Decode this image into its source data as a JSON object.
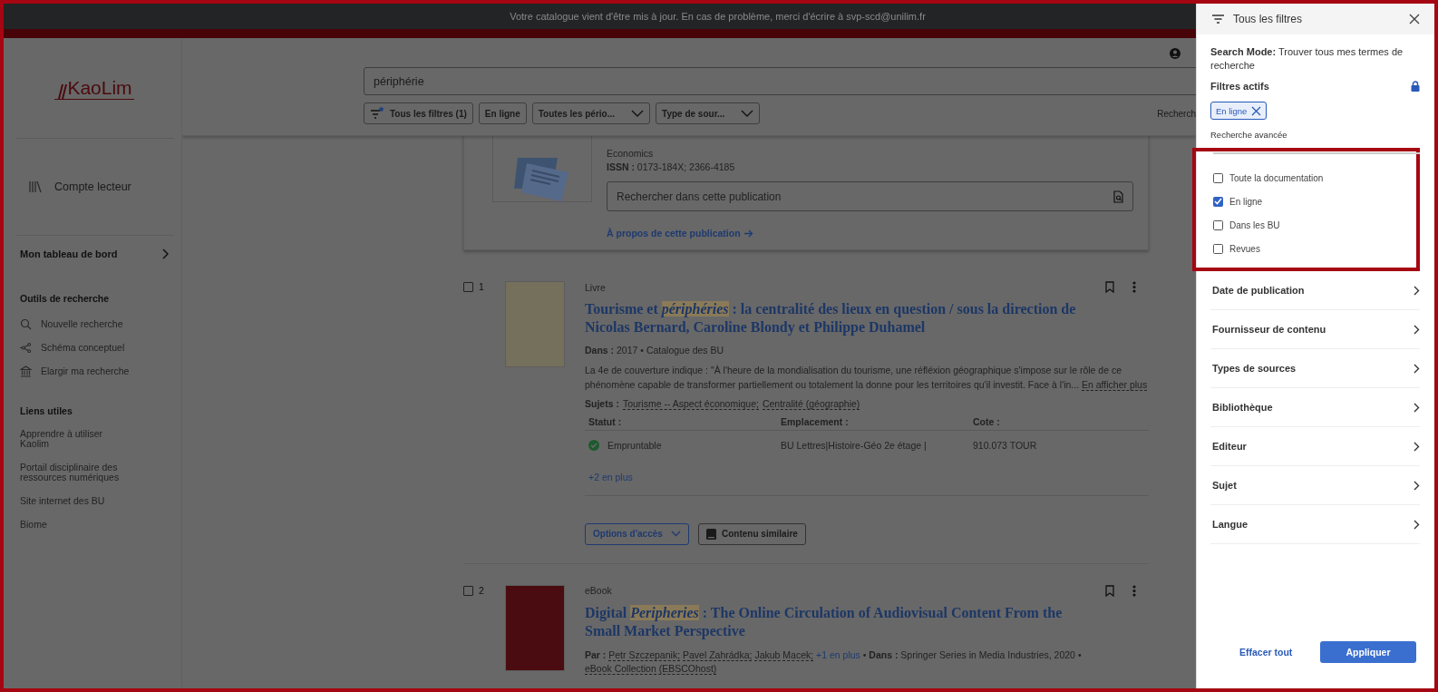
{
  "banner": {
    "text": "Votre catalogue vient d'être mis à jour. En cas de problème, merci d'écrire à svp-scd@unilim.fr"
  },
  "sidebar": {
    "logo": "KaoLim",
    "account": "Compte lecteur",
    "dashboard": "Mon tableau de bord",
    "tools": {
      "heading": "Outils de recherche",
      "items": [
        {
          "label": "Nouvelle recherche",
          "kind": "search"
        },
        {
          "label": "Schéma conceptuel",
          "kind": "graph"
        },
        {
          "label": "Elargir ma recherche",
          "kind": "institution"
        }
      ]
    },
    "links": {
      "heading": "Liens utiles",
      "items": [
        "Apprendre à utiliser Kaolim",
        "Portail disciplinaire des ressources numériques",
        "Site internet des BU",
        "Biome"
      ]
    }
  },
  "search": {
    "value": "périphérie",
    "filters": [
      {
        "label": "Tous les filtres (1)",
        "kind": "filters"
      },
      {
        "label": "En ligne",
        "kind": "plain"
      },
      {
        "label": "Toutes les pério...",
        "kind": "dropdown"
      },
      {
        "label": "Type de sour...",
        "kind": "dropdown"
      }
    ],
    "right_text": "Recherch"
  },
  "publication": {
    "subject": "Economics",
    "issn": "**ISSN :** 0173-184X; 2366-4185",
    "search_placeholder": "Rechercher dans cette publication",
    "about_link": "À propos de cette publication"
  },
  "results": [
    {
      "number": "1",
      "checked": false,
      "type": "Livre",
      "title": "Tourisme et *périphéries* : la centralité des lieux en question / sous la direction de Nicolas Bernard, Caroline Blondy et Philippe Duhamel",
      "kind": "book",
      "meta": "**Dans :** 2017 • Catalogue des BU",
      "description": "La 4e de couverture indique : \"À l'heure de la mondialisation du tourisme, une réfléxion géographique s'impose sur le rôle de ce phénomène capable de transformer partiellement ou totalement la donne pour les territoires qu'il investit. Face à l'in...",
      "more_link": "En afficher plus",
      "subjects_label": "Sujets :",
      "subjects": [
        "Tourisme -- Aspect économique;",
        "Centralité (géographie)"
      ],
      "holdings": {
        "columns": [
          "Statut :",
          "Emplacement :",
          "Cote :"
        ],
        "status": "Empruntable",
        "location": "BU Lettres|Histoire-Géo 2e étage |",
        "call_number": "910.073 TOUR",
        "more": "+2 en plus"
      },
      "access_button": "Options d'accès",
      "similar_button": "Contenu similaire"
    },
    {
      "number": "2",
      "checked": false,
      "type": "eBook",
      "title": "Digital *Peripheries* : The Online Circulation of Audiovisual Content From the Small Market Perspective",
      "kind": "ebook",
      "authors_label": "Par :",
      "authors": [
        "Petr Szczepanik;",
        "Pavel Zahrádka;",
        "Jakub Macek;"
      ],
      "authors_more": "+1 en plus",
      "separator": "•",
      "source_label": "Dans :",
      "source": "Springer Series in Media Industries, 2020 •",
      "collection": "eBook Collection (EBSCOhost)"
    }
  ],
  "filters_panel": {
    "title": "Tous les filtres",
    "search_mode_label": "Search Mode:",
    "search_mode": "Trouver tous mes termes de recherche",
    "active_heading": "Filtres actifs",
    "active_chips": [
      "En ligne"
    ],
    "advanced_heading": "Recherche avancée",
    "advanced_options": [
      {
        "label": "Toute la documentation",
        "checked": false
      },
      {
        "label": "En ligne",
        "checked": true
      },
      {
        "label": "Dans les BU",
        "checked": false
      },
      {
        "label": "Revues",
        "checked": false
      }
    ],
    "sections": [
      "Date de publication",
      "Fournisseur de contenu",
      "Types de sources",
      "Bibliothèque",
      "Editeur",
      "Sujet",
      "Langue"
    ],
    "clear": "Effacer tout",
    "apply": "Appliquer"
  }
}
